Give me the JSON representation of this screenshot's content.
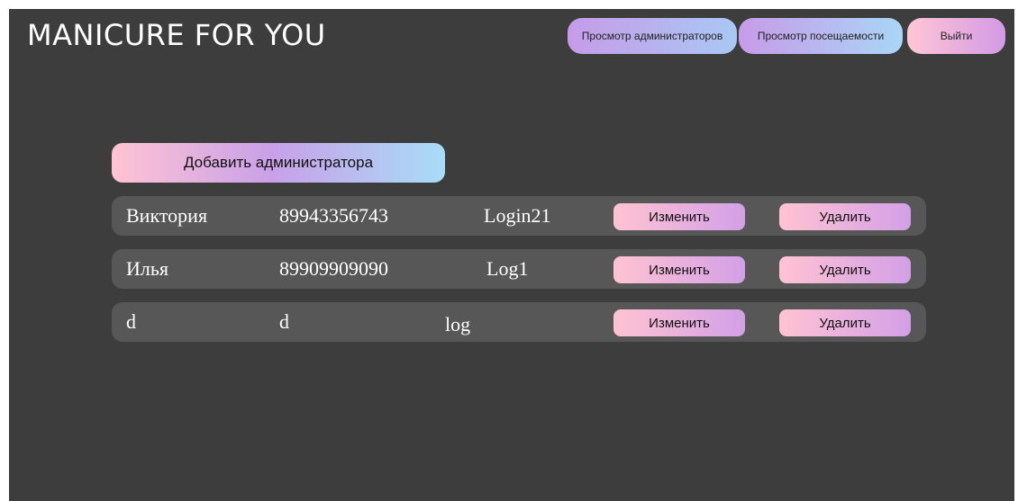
{
  "header": {
    "brand": "MANICURE FOR YOU",
    "nav": {
      "view_admins": "Просмотр администраторов",
      "view_attendance": "Просмотр посещаемости",
      "logout": "Выйти"
    }
  },
  "main": {
    "add_admin_label": "Добавить администратора",
    "edit_label": "Изменить",
    "delete_label": "Удалить",
    "admins": [
      {
        "name": "Виктория",
        "phone": "89943356743",
        "login": "Login21"
      },
      {
        "name": "Илья",
        "phone": "89909909090",
        "login": "Log1"
      },
      {
        "name": "d",
        "phone": "d",
        "login": "log"
      }
    ]
  },
  "colors": {
    "background": "#3d3d3d",
    "row": "#575757",
    "pink": "#ffc4d3",
    "purple": "#c79be8",
    "blue": "#a8dcf7"
  }
}
